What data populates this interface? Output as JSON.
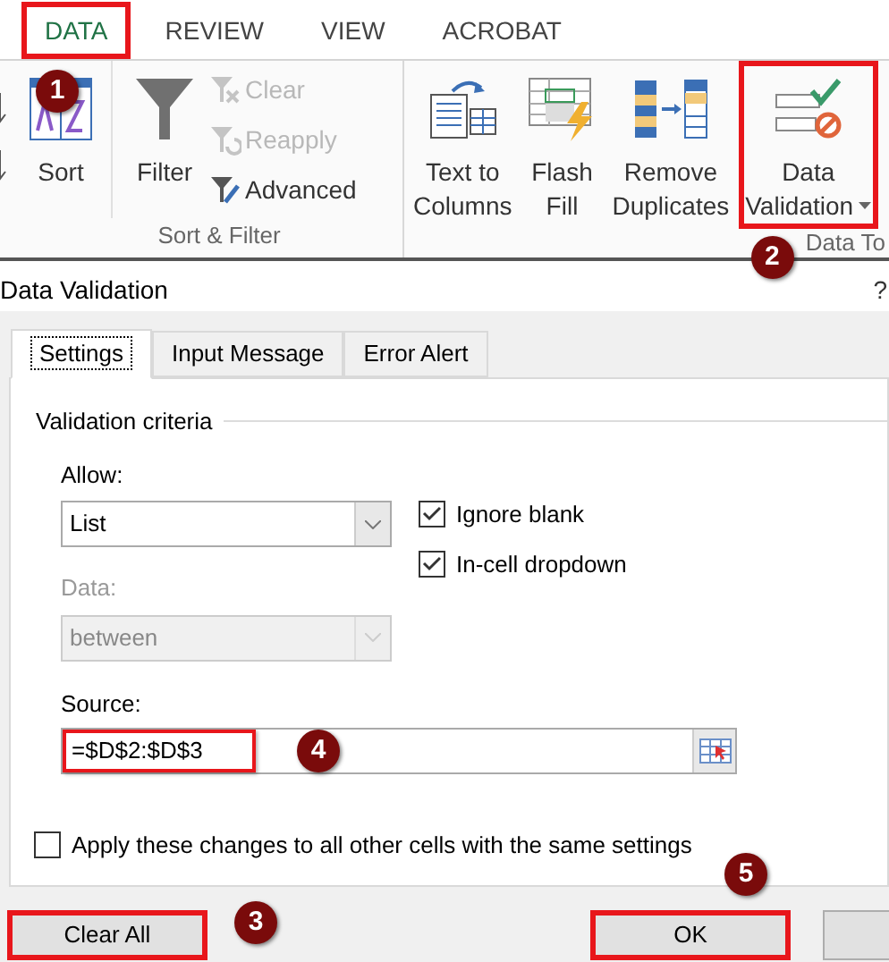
{
  "ribbon_tabs": [
    {
      "label": "DATA",
      "selected": true,
      "highlighted": true,
      "step": "1"
    },
    {
      "label": "REVIEW",
      "selected": false,
      "highlighted": false
    },
    {
      "label": "VIEW",
      "selected": false,
      "highlighted": false
    },
    {
      "label": "ACROBAT",
      "selected": false,
      "highlighted": false
    }
  ],
  "ribbon_groups": [
    {
      "label": "Sort & Filter",
      "buttons": [
        {
          "kind": "large",
          "lines": [
            "Sort"
          ]
        },
        {
          "kind": "large",
          "lines": [
            "Filter"
          ]
        },
        {
          "kind": "stack",
          "items": [
            {
              "label": "Clear",
              "disabled": true
            },
            {
              "label": "Reapply",
              "disabled": true
            },
            {
              "label": "Advanced",
              "disabled": false
            }
          ]
        }
      ]
    },
    {
      "label": "Data To",
      "buttons": [
        {
          "kind": "large",
          "lines": [
            "Text to",
            "Columns"
          ]
        },
        {
          "kind": "large",
          "lines": [
            "Flash",
            "Fill"
          ]
        },
        {
          "kind": "large",
          "lines": [
            "Remove",
            "Duplicates"
          ]
        },
        {
          "kind": "large",
          "lines": [
            "Data",
            "Validation"
          ],
          "dropdown": true,
          "highlighted": true,
          "step": "2"
        }
      ]
    }
  ],
  "dialog": {
    "title": "Data Validation",
    "help": "?",
    "tabs": [
      {
        "label": "Settings",
        "selected": true
      },
      {
        "label": "Input Message",
        "selected": false
      },
      {
        "label": "Error Alert",
        "selected": false
      }
    ],
    "section": "Validation criteria",
    "allow": {
      "label": "Allow:",
      "value": "List",
      "disabled": false
    },
    "data": {
      "label": "Data:",
      "value": "between",
      "disabled": true
    },
    "checkboxes": [
      {
        "label": "Ignore blank",
        "checked": true
      },
      {
        "label": "In-cell dropdown",
        "checked": true
      }
    ],
    "source": {
      "label": "Source:",
      "value": "=$D$2:$D$3",
      "highlighted": true,
      "step": "4"
    },
    "apply_all": {
      "label": "Apply these changes to all other cells with the same settings",
      "checked": false
    },
    "buttons": [
      {
        "label": "Clear All",
        "highlighted": true,
        "step": "3"
      },
      {
        "label": "OK",
        "highlighted": true,
        "step": "5"
      }
    ]
  }
}
